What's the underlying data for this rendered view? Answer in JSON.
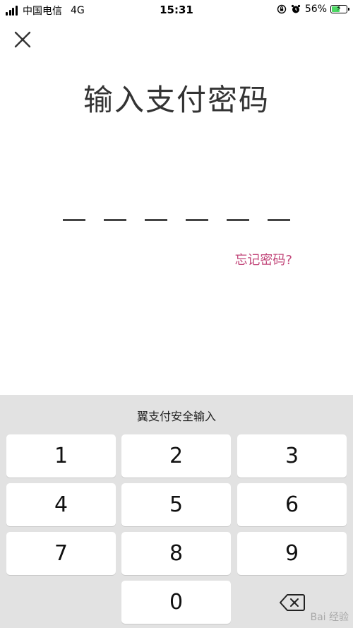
{
  "status_bar": {
    "carrier": "中国电信",
    "network": "4G",
    "time": "15:31",
    "battery": "56%",
    "battery_level": 0.56
  },
  "page": {
    "title": "输入支付密码",
    "pin_length": 6,
    "forgot_password": "忘记密码?"
  },
  "keyboard": {
    "label": "翼支付安全输入",
    "keys": [
      "1",
      "2",
      "3",
      "4",
      "5",
      "6",
      "7",
      "8",
      "9",
      "0"
    ]
  },
  "watermark": "Bai 经验"
}
